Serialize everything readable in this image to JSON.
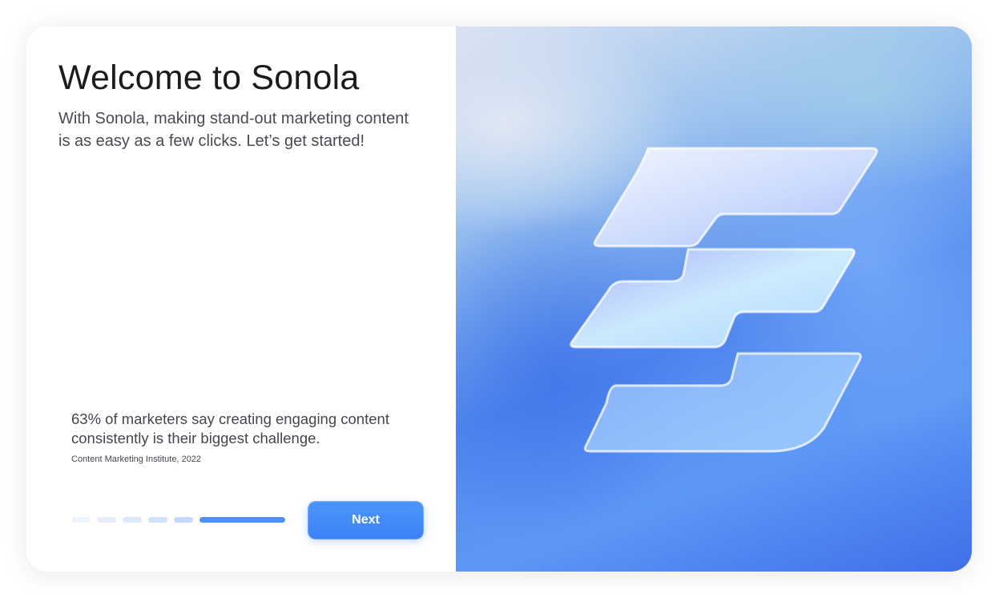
{
  "onboarding": {
    "title": "Welcome to Sonola",
    "subtitle": "With Sonola, making stand-out marketing content is as easy as a few clicks. Let’s get started!",
    "stat_text": "63% of marketers say creating engaging content consistently is their biggest challenge.",
    "stat_source": "Content Marketing Institute, 2022",
    "next_label": "Next",
    "progress": {
      "total_steps": 6,
      "current_step": 6
    }
  },
  "hero": {
    "logo_icon": "sonola-s-logo-icon"
  },
  "colors": {
    "accent": "#3b82f6",
    "title_text": "#1b1b1f",
    "body_text": "#4a4a52"
  }
}
